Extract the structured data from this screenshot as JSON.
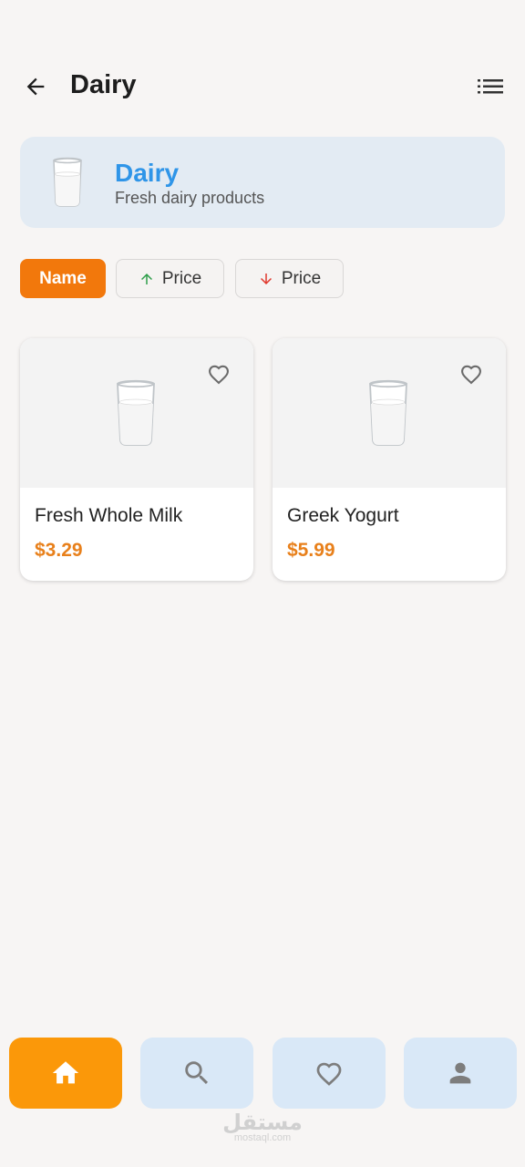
{
  "header": {
    "title": "Dairy",
    "back_icon": "arrow-left-icon",
    "menu_icon": "list-icon"
  },
  "banner": {
    "title": "Dairy",
    "subtitle": "Fresh dairy products",
    "icon": "milk-glass-icon",
    "accent_color": "#2f95e8"
  },
  "sort_chips": [
    {
      "label": "Name",
      "active": true
    },
    {
      "label": "Price",
      "direction": "ascending",
      "icon": "arrow-up-icon"
    },
    {
      "label": "Price",
      "direction": "descending",
      "icon": "arrow-down-icon"
    }
  ],
  "products": [
    {
      "name": "Fresh Whole Milk",
      "price": "$3.29",
      "icon": "milk-glass-icon"
    },
    {
      "name": "Greek Yogurt",
      "price": "$5.99",
      "icon": "milk-glass-icon"
    }
  ],
  "bottom_nav": [
    {
      "icon": "home-icon",
      "active": true
    },
    {
      "icon": "search-icon",
      "active": false
    },
    {
      "icon": "heart-icon",
      "active": false
    },
    {
      "icon": "person-icon",
      "active": false
    }
  ],
  "watermark": {
    "text": "مستقل",
    "sub": "mostaql.com"
  },
  "colors": {
    "accent": "#f2780c",
    "nav_active": "#fb9809",
    "nav_inactive": "#d9e8f7",
    "price": "#e8801b"
  }
}
